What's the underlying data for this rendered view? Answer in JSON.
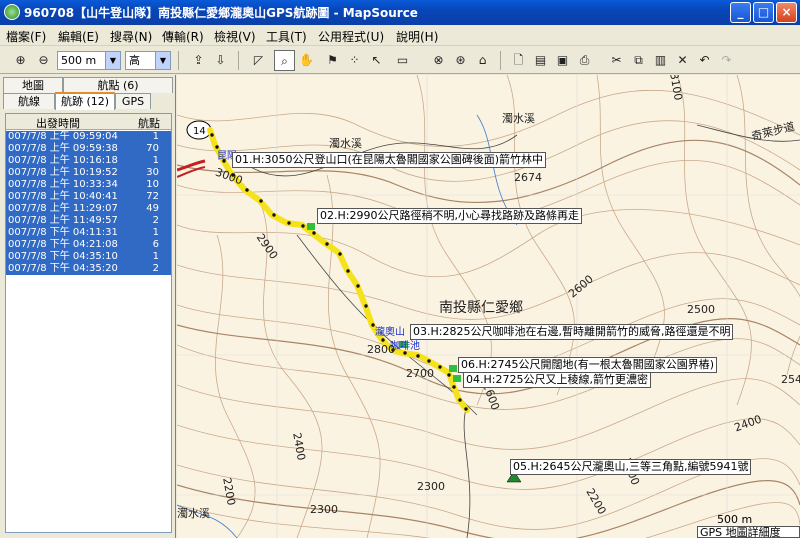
{
  "window": {
    "title": "960708【山牛登山隊】南投縣仁愛鄉瀧奧山GPS航跡圖 - MapSource",
    "min": "_",
    "max": "□",
    "close": "×"
  },
  "menu": [
    "檔案(F)",
    "編輯(E)",
    "搜尋(N)",
    "傳輸(R)",
    "檢視(V)",
    "工具(T)",
    "公用程式(U)",
    "說明(H)"
  ],
  "toolbar": {
    "zoom_level": "500 m",
    "detail_level": "高"
  },
  "tabs_top": [
    "地圖",
    "航點 (6)"
  ],
  "tabs_bottom": [
    "航線",
    "航跡 (12)",
    "GPS"
  ],
  "list": {
    "col_time": "出發時間",
    "col_points": "航點",
    "rows": [
      {
        "time": "007/7/8 上午 09:59:04",
        "points": "1"
      },
      {
        "time": "007/7/8 上午 09:59:38",
        "points": "70"
      },
      {
        "time": "007/7/8 上午 10:16:18",
        "points": "1"
      },
      {
        "time": "007/7/8 上午 10:19:52",
        "points": "30"
      },
      {
        "time": "007/7/8 上午 10:33:34",
        "points": "10"
      },
      {
        "time": "007/7/8 上午 10:40:41",
        "points": "72"
      },
      {
        "time": "007/7/8 上午 11:29:07",
        "points": "49"
      },
      {
        "time": "007/7/8 上午 11:49:57",
        "points": "2"
      },
      {
        "time": "007/7/8 下午 04:11:31",
        "points": "1"
      },
      {
        "time": "007/7/8 下午 04:21:08",
        "points": "6"
      },
      {
        "time": "007/7/8 下午 04:35:10",
        "points": "1"
      },
      {
        "time": "007/7/8 下午 04:35:20",
        "points": "2"
      }
    ]
  },
  "map": {
    "waypoints": [
      "01.H:3050公尺登山口(在昆陽太魯閣國家公園碑後面)箭竹林中",
      "02.H:2990公尺路徑稍不明,小心尋找路跡及路條再走",
      "03.H:2825公尺咖啡池在右邊,暫時離開箭竹的威脅,路徑還是不明",
      "06.H:2745公尺開闊地(有一根太魯閣國家公園界樁)",
      "04.H:2725公尺又上稜線,箭竹更濃密",
      "05.H:2645公尺瀧奧山,三等三角點,編號5941號"
    ],
    "place_labels": [
      "濁水溪",
      "濁水溪",
      "南投縣仁愛鄉",
      "奇萊步道",
      "濁水溪"
    ],
    "blue_labels": [
      "昆陽",
      "瀧奧山",
      "咖啡池"
    ],
    "elevations": [
      "3100",
      "3000",
      "2900",
      "2800",
      "2700",
      "2674",
      "2600",
      "2500",
      "2400",
      "2300",
      "2200",
      "2600",
      "2500",
      "2400",
      "254",
      "2900",
      "2300",
      "2200"
    ],
    "road_marker": "14",
    "scale_label": "500 m",
    "detail_label": "GPS 地圖詳細度"
  }
}
